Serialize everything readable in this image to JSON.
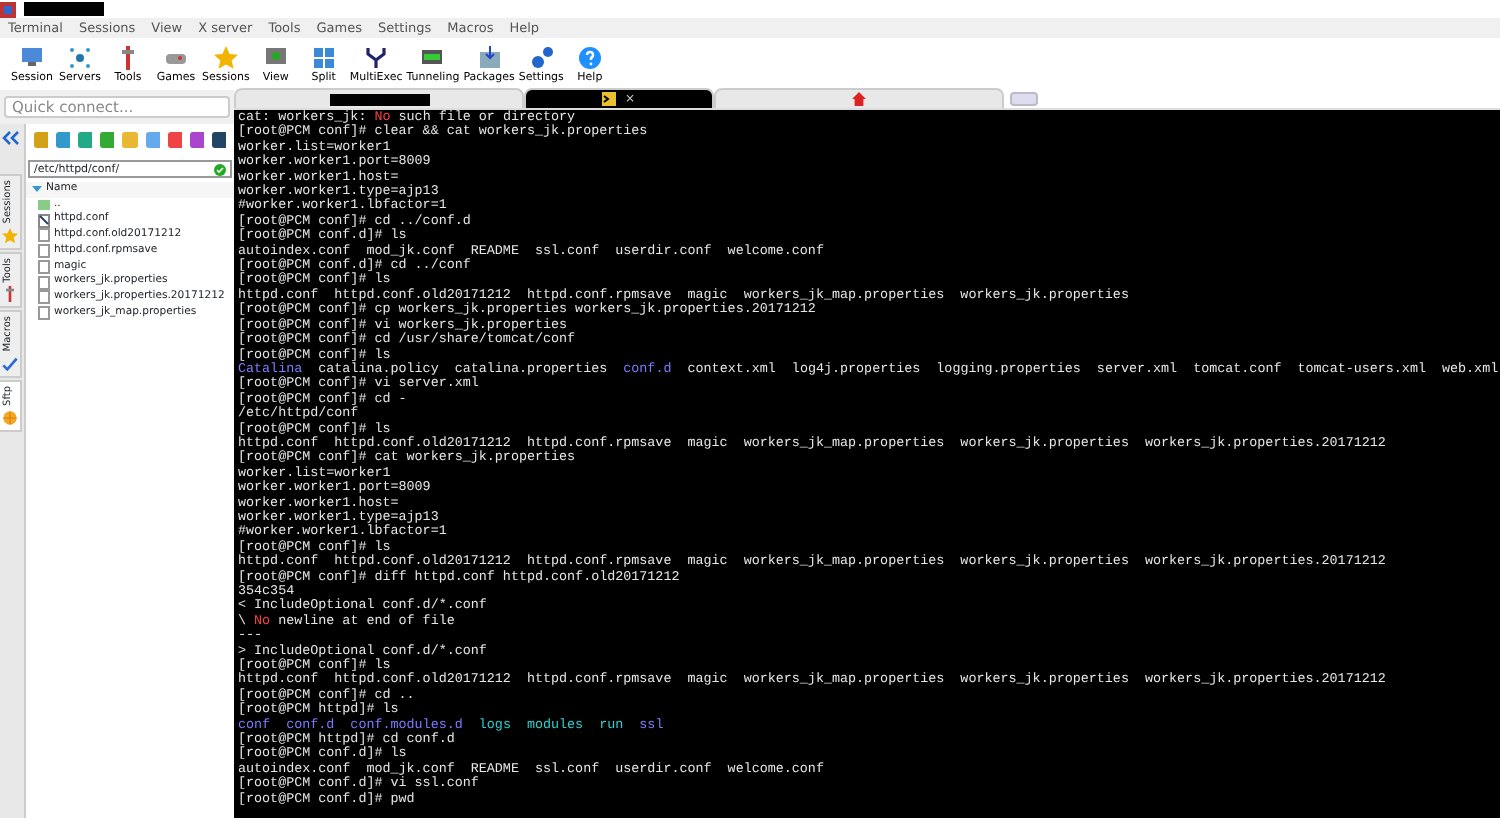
{
  "menu": [
    "Terminal",
    "Sessions",
    "View",
    "X server",
    "Tools",
    "Games",
    "Settings",
    "Macros",
    "Help"
  ],
  "toolbar": [
    "Session",
    "Servers",
    "Tools",
    "Games",
    "Sessions",
    "View",
    "Split",
    "MultiExec",
    "Tunneling",
    "Packages",
    "Settings",
    "Help"
  ],
  "quick_connect": {
    "placeholder": "Quick connect..."
  },
  "side_tabs": [
    {
      "label": "Sessions",
      "selected": false
    },
    {
      "label": "Tools",
      "selected": false
    },
    {
      "label": "Macros",
      "selected": false
    },
    {
      "label": "Sftp",
      "selected": true
    }
  ],
  "sftp": {
    "path": "/etc/httpd/conf/",
    "column": "Name",
    "files": [
      {
        "name": "..",
        "kind": "folder"
      },
      {
        "name": "httpd.conf",
        "kind": "link"
      },
      {
        "name": "httpd.conf.old20171212",
        "kind": "file"
      },
      {
        "name": "httpd.conf.rpmsave",
        "kind": "file"
      },
      {
        "name": "magic",
        "kind": "file"
      },
      {
        "name": "workers_jk.properties",
        "kind": "file"
      },
      {
        "name": "workers_jk.properties.20171212",
        "kind": "file"
      },
      {
        "name": "workers_jk_map.properties",
        "kind": "file"
      }
    ]
  },
  "tabs": [
    {
      "kind": "session",
      "selected": false
    },
    {
      "kind": "session",
      "selected": true,
      "close": "×"
    },
    {
      "kind": "home",
      "selected": false
    }
  ],
  "terminal": [
    [
      {
        "t": "cat: workers_jk: "
      },
      {
        "t": "No",
        "kind": "error"
      },
      {
        "t": " such file or directory"
      }
    ],
    [
      {
        "t": "[root@PCM conf]# clear && cat workers_jk.properties"
      }
    ],
    [
      {
        "t": "worker.list=worker1"
      }
    ],
    [
      {
        "t": "worker.worker1.port=8009"
      }
    ],
    [
      {
        "t": "worker.worker1.host="
      }
    ],
    [
      {
        "t": "worker.worker1.type=ajp13"
      }
    ],
    [
      {
        "t": "#worker.worker1.lbfactor=1"
      }
    ],
    [
      {
        "t": "[root@PCM conf]# cd ../conf.d"
      }
    ],
    [
      {
        "t": "[root@PCM conf.d]# ls"
      }
    ],
    [
      {
        "t": "autoindex.conf  mod_jk.conf  README  ssl.conf  userdir.conf  welcome.conf"
      }
    ],
    [
      {
        "t": "[root@PCM conf.d]# cd ../conf"
      }
    ],
    [
      {
        "t": "[root@PCM conf]# ls"
      }
    ],
    [
      {
        "t": "httpd.conf  httpd.conf.old20171212  httpd.conf.rpmsave  magic  workers_jk_map.properties  workers_jk.properties"
      }
    ],
    [
      {
        "t": "[root@PCM conf]# cp workers_jk.properties workers_jk.properties.20171212"
      }
    ],
    [
      {
        "t": "[root@PCM conf]# vi workers_jk.properties"
      }
    ],
    [
      {
        "t": "[root@PCM conf]# cd /usr/share/tomcat/conf"
      }
    ],
    [
      {
        "t": "[root@PCM conf]# ls"
      }
    ],
    [
      {
        "t": "Catalina",
        "kind": "dir"
      },
      {
        "t": "  catalina.policy  catalina.properties  "
      },
      {
        "t": "conf.d",
        "kind": "dir"
      },
      {
        "t": "  context.xml  log4j.properties  logging.properties  server.xml  tomcat.conf  tomcat-users.xml  web.xml"
      }
    ],
    [
      {
        "t": "[root@PCM conf]# vi server.xml"
      }
    ],
    [
      {
        "t": "[root@PCM conf]# cd -"
      }
    ],
    [
      {
        "t": "/etc/httpd/conf"
      }
    ],
    [
      {
        "t": "[root@PCM conf]# ls"
      }
    ],
    [
      {
        "t": "httpd.conf  httpd.conf.old20171212  httpd.conf.rpmsave  magic  workers_jk_map.properties  workers_jk.properties  workers_jk.properties.20171212"
      }
    ],
    [
      {
        "t": "[root@PCM conf]# cat workers_jk.properties"
      }
    ],
    [
      {
        "t": "worker.list=worker1"
      }
    ],
    [
      {
        "t": "worker.worker1.port=8009"
      }
    ],
    [
      {
        "t": "worker.worker1.host="
      }
    ],
    [
      {
        "t": "worker.worker1.type=ajp13"
      }
    ],
    [
      {
        "t": "#worker.worker1.lbfactor=1"
      }
    ],
    [
      {
        "t": "[root@PCM conf]# ls"
      }
    ],
    [
      {
        "t": "httpd.conf  httpd.conf.old20171212  httpd.conf.rpmsave  magic  workers_jk_map.properties  workers_jk.properties  workers_jk.properties.20171212"
      }
    ],
    [
      {
        "t": "[root@PCM conf]# diff httpd.conf httpd.conf.old20171212"
      }
    ],
    [
      {
        "t": "354c354"
      }
    ],
    [
      {
        "t": "< IncludeOptional conf.d/*.conf"
      }
    ],
    [
      {
        "t": "\\ "
      },
      {
        "t": "No",
        "kind": "error"
      },
      {
        "t": " newline at end of file"
      }
    ],
    [
      {
        "t": "---"
      }
    ],
    [
      {
        "t": "> IncludeOptional conf.d/*.conf"
      }
    ],
    [
      {
        "t": "[root@PCM conf]# ls"
      }
    ],
    [
      {
        "t": "httpd.conf  httpd.conf.old20171212  httpd.conf.rpmsave  magic  workers_jk_map.properties  workers_jk.properties  workers_jk.properties.20171212"
      }
    ],
    [
      {
        "t": "[root@PCM conf]# cd .."
      }
    ],
    [
      {
        "t": "[root@PCM httpd]# ls"
      }
    ],
    [
      {
        "t": "conf  conf.d  conf.modules.d",
        "kind": "dir"
      },
      {
        "t": "  logs  modules  run",
        "kind": "link"
      },
      {
        "t": "  ssl",
        "kind": "dir"
      }
    ],
    [
      {
        "t": "[root@PCM httpd]# cd conf.d"
      }
    ],
    [
      {
        "t": "[root@PCM conf.d]# ls"
      }
    ],
    [
      {
        "t": "autoindex.conf  mod_jk.conf  README  ssl.conf  userdir.conf  welcome.conf"
      }
    ],
    [
      {
        "t": "[root@PCM conf.d]# vi ssl.conf"
      }
    ],
    [
      {
        "t": "[root@PCM conf.d]# pwd"
      }
    ]
  ]
}
